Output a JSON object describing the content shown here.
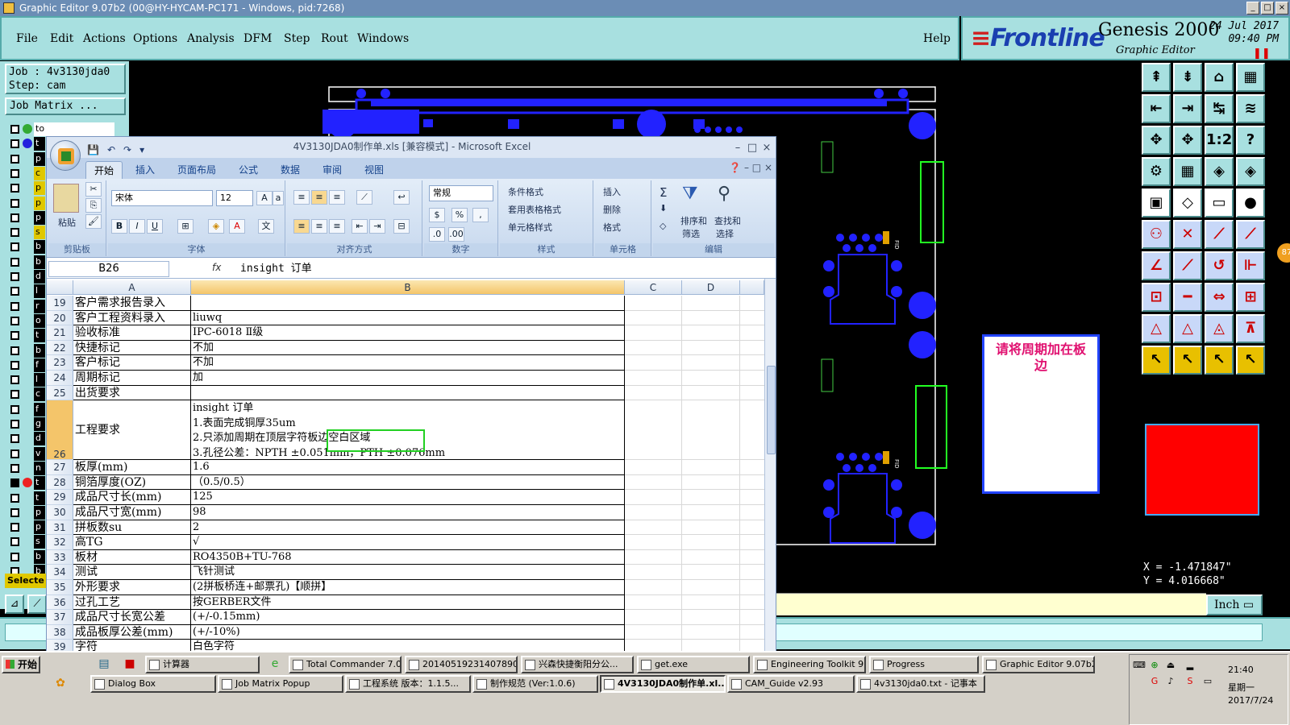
{
  "genesis": {
    "title": "Graphic Editor 9.07b2 (00@HY-HYCAM-PC171 - Windows, pid:7268)",
    "menu": [
      "File",
      "Edit",
      "Actions",
      "Options",
      "Analysis",
      "DFM",
      "Step",
      "Rout",
      "Windows"
    ],
    "help": "Help",
    "brand": {
      "logo": "Frontline",
      "product": "Genesis 2000",
      "subtitle": "Graphic Editor",
      "date": "24 Jul 2017",
      "time": "09:40 PM"
    },
    "job_line": "Job : 4v3130jda0",
    "step_line": "Step: cam",
    "job_matrix": "Job Matrix ...",
    "layers": [
      {
        "label": "to",
        "state": "hidden"
      },
      {
        "label": "t",
        "state": "hidden"
      },
      {
        "label": "p",
        "state": "hidden"
      },
      {
        "label": "c",
        "state": "yellow"
      },
      {
        "label": "p",
        "state": "yellow"
      },
      {
        "label": "p",
        "state": "yellow"
      },
      {
        "label": "p",
        "state": "hidden"
      },
      {
        "label": "s",
        "state": "yellow"
      },
      {
        "label": "b",
        "state": "hidden"
      },
      {
        "label": "b",
        "state": "hidden"
      },
      {
        "label": "d",
        "state": "hidden"
      },
      {
        "label": "l",
        "state": "hidden"
      },
      {
        "label": "r",
        "state": "hidden"
      },
      {
        "label": "o",
        "state": "hidden"
      },
      {
        "label": "t",
        "state": "hidden"
      },
      {
        "label": "b",
        "state": "hidden"
      },
      {
        "label": "f",
        "state": "hidden"
      },
      {
        "label": "l",
        "state": "hidden"
      },
      {
        "label": "c",
        "state": "hidden"
      },
      {
        "label": "f",
        "state": "hidden"
      },
      {
        "label": "g",
        "state": "hidden"
      },
      {
        "label": "d",
        "state": "hidden"
      },
      {
        "label": "v",
        "state": "hidden"
      },
      {
        "label": "n",
        "state": "hidden"
      },
      {
        "label": "t",
        "state": "selected"
      },
      {
        "label": "t",
        "state": "hidden"
      },
      {
        "label": "p",
        "state": "hidden"
      },
      {
        "label": "p",
        "state": "hidden"
      },
      {
        "label": "s",
        "state": "hidden"
      },
      {
        "label": "b",
        "state": "hidden"
      },
      {
        "label": "b",
        "state": "hidden"
      }
    ],
    "selected_label": "Selecte",
    "note_text": "请将周期加在板边",
    "coords": {
      "x": "X = -1.471847\"",
      "y": "Y = 4.016668\""
    },
    "unit": "Inch",
    "tools": [
      "⇞",
      "⇟",
      "⌂",
      "▦",
      "⇤",
      "⇥",
      "↹",
      "≋",
      "✥",
      "✥",
      "1:2",
      "?",
      "⚙",
      "▦",
      "◈",
      "◈",
      "▣",
      "◇",
      "▭",
      "●",
      "⚇",
      "✕",
      "⟋",
      "⟋",
      "∠",
      "⟋",
      "↺",
      "⊩",
      "⊡",
      "━",
      "⇔",
      "⊞",
      "△",
      "△",
      "◬",
      "⊼",
      "↖",
      "↖",
      "↖",
      "↖"
    ],
    "badge": "87"
  },
  "excel": {
    "title": "4V3130JDA0制作单.xls [兼容模式] - Microsoft Excel",
    "tabs": [
      "开始",
      "插入",
      "页面布局",
      "公式",
      "数据",
      "审阅",
      "视图"
    ],
    "ribbon": {
      "paste": "粘贴",
      "clipboard": "剪贴板",
      "font_name": "宋体",
      "font_size": "12",
      "font_group": "字体",
      "align_group": "对齐方式",
      "number_format": "常规",
      "number_group": "数字",
      "cond_format": "条件格式",
      "table_format": "套用表格格式",
      "cell_style": "单元格样式",
      "style_group": "样式",
      "insert": "插入",
      "delete": "删除",
      "format": "格式",
      "cells_group": "单元格",
      "sort": "排序和",
      "sort2": "筛选",
      "find": "查找和",
      "find2": "选择",
      "edit_group": "编辑",
      "font_buttons": [
        "B",
        "I",
        "U"
      ]
    },
    "name_box": "B26",
    "formula": "insight 订单",
    "columns": [
      "A",
      "B",
      "C",
      "D"
    ],
    "rows": [
      {
        "n": "19",
        "a": "客户需求报告录入",
        "b": ""
      },
      {
        "n": "20",
        "a": "客户工程资料录入",
        "b": "liuwq"
      },
      {
        "n": "21",
        "a": "验收标准",
        "b": "IPC-6018 Ⅱ级"
      },
      {
        "n": "22",
        "a": "快捷标记",
        "b": "不加"
      },
      {
        "n": "23",
        "a": "客户标记",
        "b": "不加"
      },
      {
        "n": "24",
        "a": "周期标记",
        "b": "加"
      },
      {
        "n": "25",
        "a": "出货要求",
        "b": ""
      }
    ],
    "row26": {
      "n": "26",
      "a": "工程要求",
      "lines": [
        "insight 订单",
        "1.表面完成铜厚35um",
        "2.只添加周期在顶层字符板边空白区域",
        "3.孔径公差：NPTH ±0.051mm，PTH ±0.076mm"
      ]
    },
    "rows2": [
      {
        "n": "27",
        "a": "板厚(mm)",
        "b": "1.6"
      },
      {
        "n": "28",
        "a": "铜箔厚度(OZ)",
        "b": "（0.5/0.5）"
      },
      {
        "n": "29",
        "a": "成品尺寸长(mm)",
        "b": "125"
      },
      {
        "n": "30",
        "a": "成品尺寸宽(mm)",
        "b": "98"
      },
      {
        "n": "31",
        "a": "拼板数su",
        "b": "2"
      },
      {
        "n": "32",
        "a": "高TG",
        "b": "√"
      },
      {
        "n": "33",
        "a": "板材",
        "b": "RO4350B+TU-768"
      },
      {
        "n": "34",
        "a": "测试",
        "b": "飞针测试"
      },
      {
        "n": "35",
        "a": "外形要求",
        "b": "(2拼板桥连+邮票孔)【顺拼】"
      },
      {
        "n": "36",
        "a": "过孔工艺",
        "b": "按GERBER文件"
      },
      {
        "n": "37",
        "a": "成品尺寸长宽公差",
        "b": "(+/-0.15mm)"
      },
      {
        "n": "38",
        "a": "成品板厚公差(mm)",
        "b": "(+/-10%)"
      },
      {
        "n": "39",
        "a": "字符",
        "b": "白色字符"
      }
    ]
  },
  "taskbar": {
    "start": "开始",
    "row1": [
      "计算器",
      "Total Commander 7.0...",
      "20140519231407890...",
      "兴森快捷衡阳分公...",
      "get.exe",
      "Engineering Toolkit 9....",
      "Progress",
      "Graphic Editor 9.07b2..."
    ],
    "row2": [
      "Dialog Box",
      "Job Matrix Popup",
      "工程系统  版本：1.1.5...",
      "制作规范 (Ver:1.0.6)",
      "4V3130JDA0制作单.xl...",
      "CAM_Guide v2.93",
      "4v3130jda0.txt - 记事本"
    ],
    "time": "21:40",
    "day": "星期一",
    "date": "2017/7/24"
  }
}
